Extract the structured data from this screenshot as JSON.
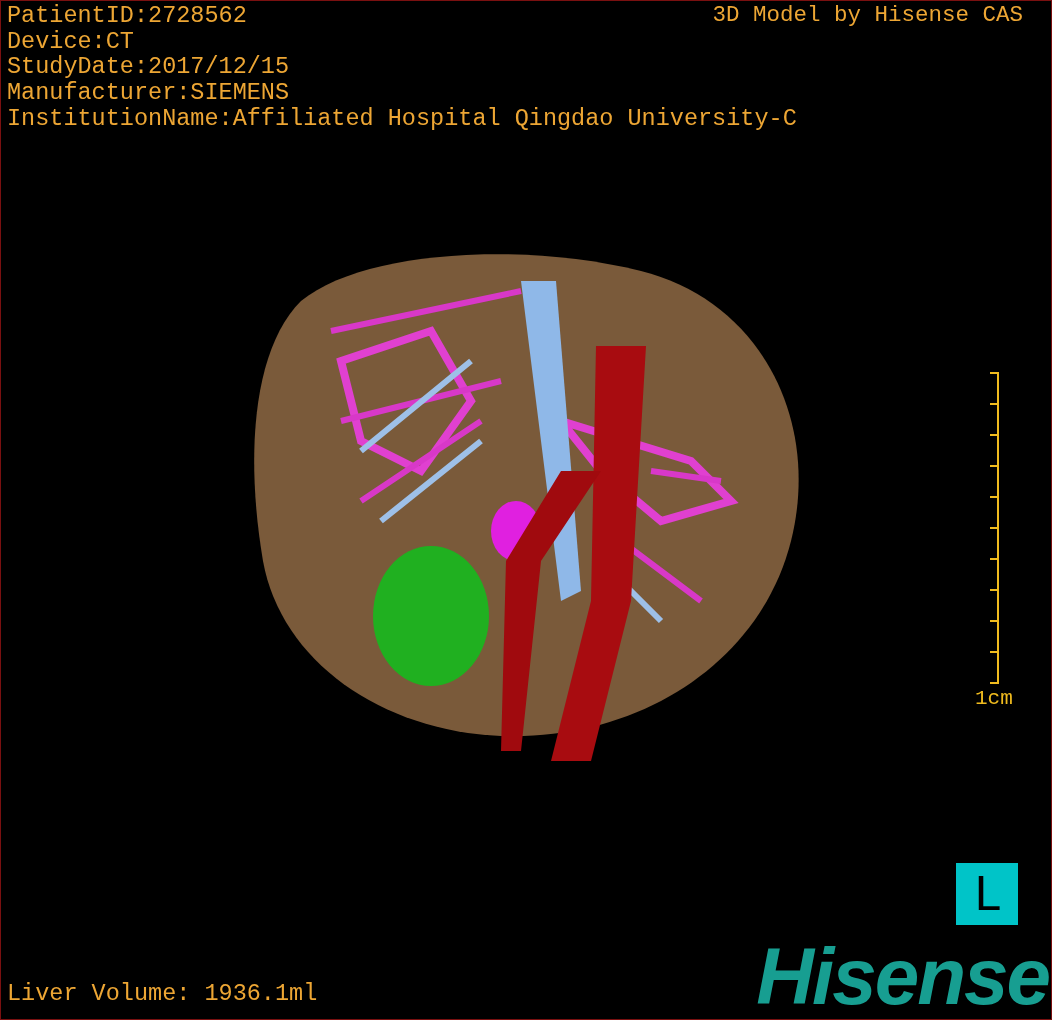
{
  "info_lines": [
    "PatientID:2728562",
    "Device:CT",
    "StudyDate:2017/12/15",
    "Manufacturer:SIEMENS",
    "InstitutionName:Affiliated Hospital Qingdao University-C"
  ],
  "model_credit": "3D Model by Hisense CAS",
  "scale_bar": {
    "label": "1cm"
  },
  "orientation_marker": "L",
  "liver_volume": "Liver Volume: 1936.1ml",
  "logo": "Hisense"
}
